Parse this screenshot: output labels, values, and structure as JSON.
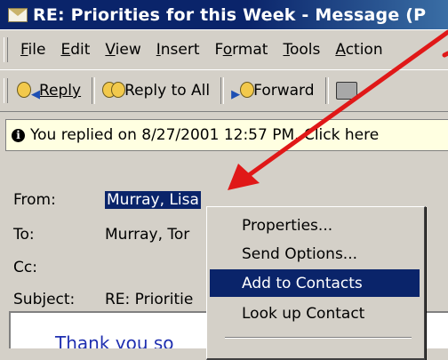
{
  "window": {
    "title": "RE: Priorities for this Week - Message (P"
  },
  "menubar": {
    "items": [
      {
        "underline": "F",
        "rest": "ile"
      },
      {
        "underline": "E",
        "rest": "dit"
      },
      {
        "underline": "V",
        "rest": "iew"
      },
      {
        "underline": "I",
        "rest": "nsert"
      },
      {
        "pre": "F",
        "underline": "o",
        "rest": "rmat"
      },
      {
        "underline": "T",
        "rest": "ools"
      },
      {
        "underline": "A",
        "rest": "ction"
      }
    ]
  },
  "toolbar": {
    "reply_label": "Reply",
    "reply_all_label": "Reply to All",
    "forward_label": "Forward"
  },
  "infobar": {
    "text": "You replied on 8/27/2001 12:57 PM. Click here"
  },
  "header": {
    "from_label": "From:",
    "from_value": "Murray, Lisa",
    "to_label": "To:",
    "to_value": "Murray, Tor",
    "cc_label": "Cc:",
    "cc_value": "",
    "subject_label": "Subject:",
    "subject_value": "RE: Prioritie"
  },
  "context_menu": {
    "items": [
      "Properties...",
      "Send Options...",
      "Add to Contacts",
      "Look up Contact"
    ],
    "highlighted": "Add to Contacts"
  },
  "body": {
    "text": "Thank you so"
  },
  "colors": {
    "titlebar": "#0a246a",
    "selection": "#0a246a",
    "annotation_arrow": "#e01818",
    "infobar_bg": "#ffffe1"
  }
}
